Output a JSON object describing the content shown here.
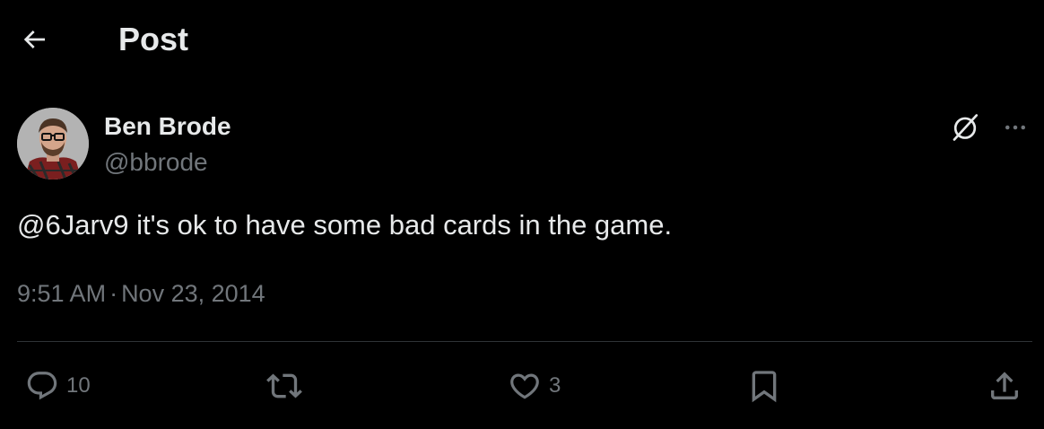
{
  "header": {
    "title": "Post"
  },
  "post": {
    "author": {
      "name": "Ben Brode",
      "handle": "@bbrode"
    },
    "text": "@6Jarv9 it's ok to have some bad cards in the game.",
    "time": "9:51 AM",
    "separator": "·",
    "date": "Nov 23, 2014"
  },
  "actions": {
    "replies": "10",
    "likes": "3"
  },
  "icons": {
    "back": "arrow-left-icon",
    "grok": "grok-icon",
    "more": "more-horizontal-icon",
    "reply": "reply-icon",
    "repost": "repost-icon",
    "like": "heart-icon",
    "bookmark": "bookmark-icon",
    "share": "share-icon"
  },
  "colors": {
    "background": "#000000",
    "text": "#e7e9ea",
    "secondary": "#71767b",
    "divider": "#2f3336"
  }
}
